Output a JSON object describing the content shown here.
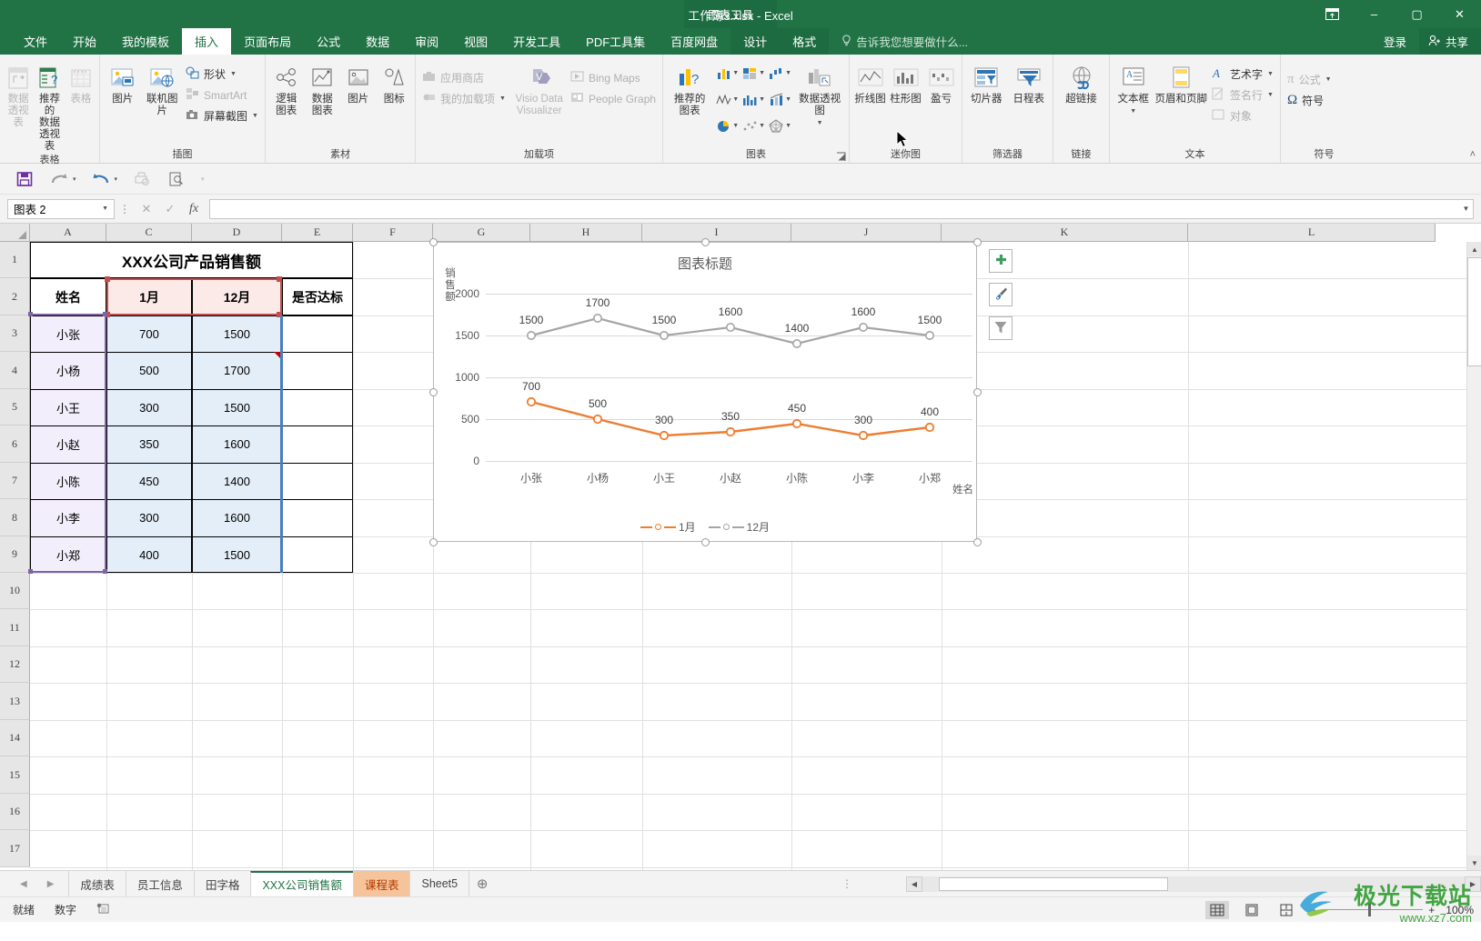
{
  "window": {
    "title": "工作簿3.xlsx - Excel",
    "context_tab_group": "图表工具",
    "ribbon_display_icon": "ribbon-display-options-icon",
    "minimize": "–",
    "maximize": "▢",
    "close": "✕"
  },
  "header": {
    "tabs": [
      {
        "label": "文件",
        "active": false
      },
      {
        "label": "开始",
        "active": false
      },
      {
        "label": "我的模板",
        "active": false
      },
      {
        "label": "插入",
        "active": true
      },
      {
        "label": "页面布局",
        "active": false
      },
      {
        "label": "公式",
        "active": false
      },
      {
        "label": "数据",
        "active": false
      },
      {
        "label": "审阅",
        "active": false
      },
      {
        "label": "视图",
        "active": false
      },
      {
        "label": "开发工具",
        "active": false
      },
      {
        "label": "PDF工具集",
        "active": false
      },
      {
        "label": "百度网盘",
        "active": false
      }
    ],
    "context_tabs": [
      {
        "label": "设计",
        "active": true
      },
      {
        "label": "格式",
        "active": false
      }
    ],
    "tell_me": "告诉我您想要做什么...",
    "signin": "登录",
    "share": "共享"
  },
  "ribbon": {
    "groups": [
      {
        "name": "表格",
        "label": "表格",
        "big_buttons": [
          {
            "label": "数据\n透视表",
            "line1": "数据",
            "line2": "透视表",
            "icon": "pivot-table-icon",
            "disabled": true
          },
          {
            "label": "推荐的\n数据透视表",
            "line1": "推荐的",
            "line2": "数据透视表",
            "icon": "recommended-pivot-icon",
            "disabled": false
          },
          {
            "label": "表格",
            "line1": "表格",
            "line2": "",
            "icon": "table-icon",
            "disabled": true
          }
        ]
      },
      {
        "name": "插图",
        "label": "插图",
        "big_buttons": [
          {
            "line1": "图片",
            "line2": "",
            "icon": "picture-icon",
            "disabled": false
          },
          {
            "line1": "联机图片",
            "line2": "",
            "icon": "online-picture-icon",
            "disabled": false
          }
        ],
        "small_rows": [
          {
            "label": "形状",
            "icon": "shapes-icon",
            "caret": true,
            "disabled": false
          },
          {
            "label": "SmartArt",
            "icon": "smartart-icon",
            "caret": false,
            "disabled": true
          },
          {
            "label": "屏幕截图",
            "icon": "screenshot-icon",
            "caret": true,
            "disabled": false
          }
        ]
      },
      {
        "name": "素材",
        "label": "素材",
        "big_buttons": [
          {
            "line1": "逻辑",
            "line2": "图表",
            "icon": "logic-diagram-icon",
            "disabled": false
          },
          {
            "line1": "数据",
            "line2": "图表",
            "icon": "data-chart-icon",
            "disabled": false
          },
          {
            "line1": "图片",
            "line2": "",
            "icon": "material-picture-icon",
            "disabled": false
          },
          {
            "line1": "图标",
            "line2": "",
            "icon": "material-icon-icon",
            "disabled": false
          }
        ]
      },
      {
        "name": "加载项",
        "label": "加载项",
        "small_rows": [
          {
            "label": "应用商店",
            "icon": "store-icon",
            "caret": false,
            "disabled": true
          },
          {
            "label": "我的加载项",
            "icon": "my-addins-icon",
            "caret": true,
            "disabled": true
          }
        ],
        "big_buttons": [
          {
            "line1": "Visio Data",
            "line2": "Visualizer",
            "icon": "visio-data-visualizer-icon",
            "disabled": true
          }
        ],
        "small_rows2": [
          {
            "label": "Bing Maps",
            "icon": "bing-maps-icon",
            "caret": false,
            "disabled": true
          },
          {
            "label": "People Graph",
            "icon": "people-graph-icon",
            "caret": false,
            "disabled": true
          }
        ]
      },
      {
        "name": "图表",
        "label": "图表",
        "big_buttons": [
          {
            "line1": "推荐的",
            "line2": "图表",
            "icon": "recommended-charts-icon",
            "disabled": false
          },
          {
            "line1": "数据透视图",
            "line2": "",
            "icon": "pivot-chart-icon",
            "disabled": false
          }
        ],
        "mini_icons": [
          "column-chart-icon",
          "hierarchy-chart-icon",
          "waterfall-chart-icon",
          "line-chart-icon",
          "statistic-chart-icon",
          "combo-chart-icon",
          "pie-chart-icon",
          "scatter-chart-icon",
          "radar-chart-icon"
        ],
        "has_launcher": true
      },
      {
        "name": "迷你图",
        "label": "迷你图",
        "big_buttons": [
          {
            "line1": "折线图",
            "line2": "",
            "icon": "sparkline-line-icon",
            "disabled": false
          },
          {
            "line1": "柱形图",
            "line2": "",
            "icon": "sparkline-column-icon",
            "disabled": false
          },
          {
            "line1": "盈亏",
            "line2": "",
            "icon": "sparkline-winloss-icon",
            "disabled": false
          }
        ]
      },
      {
        "name": "筛选器",
        "label": "筛选器",
        "big_buttons": [
          {
            "line1": "切片器",
            "line2": "",
            "icon": "slicer-icon",
            "disabled": false
          },
          {
            "line1": "日程表",
            "line2": "",
            "icon": "timeline-icon",
            "disabled": false
          }
        ]
      },
      {
        "name": "链接",
        "label": "链接",
        "big_buttons": [
          {
            "line1": "超链接",
            "line2": "",
            "icon": "hyperlink-icon",
            "disabled": false
          }
        ]
      },
      {
        "name": "文本",
        "label": "文本",
        "big_buttons": [
          {
            "line1": "文本框",
            "line2": "",
            "icon": "textbox-icon",
            "disabled": false
          },
          {
            "line1": "页眉和页脚",
            "line2": "",
            "icon": "header-footer-icon",
            "disabled": false
          }
        ],
        "small_rows": [
          {
            "label": "艺术字",
            "icon": "wordart-icon",
            "caret": true,
            "disabled": false
          },
          {
            "label": "签名行",
            "icon": "signature-line-icon",
            "caret": true,
            "disabled": true
          },
          {
            "label": "对象",
            "icon": "object-icon",
            "caret": false,
            "disabled": true
          }
        ]
      },
      {
        "name": "符号",
        "label": "符号",
        "small_rows": [
          {
            "label": "公式",
            "icon": "equation-icon",
            "caret": true,
            "disabled": true
          },
          {
            "label": "符号",
            "icon": "symbol-icon",
            "caret": false,
            "disabled": false
          }
        ]
      }
    ],
    "collapse_icon": "collapse-ribbon-icon"
  },
  "quick_access": [
    {
      "name": "save-icon",
      "glyph": "💾",
      "disabled": false
    },
    {
      "name": "redo-icon",
      "glyph": "↷",
      "disabled": false
    },
    {
      "name": "undo-icon",
      "glyph": "↶",
      "disabled": false
    },
    {
      "name": "print-preview-icon",
      "glyph": "🖶",
      "disabled": true
    },
    {
      "name": "print-preview-magnifier-icon",
      "glyph": "🔍",
      "disabled": false
    },
    {
      "name": "customize-qat-icon",
      "glyph": "▾",
      "disabled": true
    }
  ],
  "formula_bar": {
    "name_box_value": "图表 2",
    "cancel_icon": "cancel-icon",
    "confirm_icon": "confirm-icon",
    "fx_icon": "insert-function-icon",
    "value": "",
    "expand_icon": "expand-formula-bar-icon"
  },
  "grid": {
    "columns": [
      "A",
      "C",
      "D",
      "E",
      "F",
      "G",
      "H",
      "I",
      "J",
      "K",
      "L"
    ],
    "rows": [
      "1",
      "2",
      "3",
      "4",
      "5",
      "6",
      "7",
      "8",
      "9",
      "10",
      "11",
      "12",
      "13",
      "14",
      "15",
      "16",
      "17"
    ],
    "table": {
      "title": "XXX公司产品销售额",
      "headers": [
        "姓名",
        "1月",
        "12月",
        "是否达标"
      ],
      "rows": [
        {
          "name": "小张",
          "jan": "700",
          "dec": "1500",
          "ok": ""
        },
        {
          "name": "小杨",
          "jan": "500",
          "dec": "1700",
          "ok": ""
        },
        {
          "name": "小王",
          "jan": "300",
          "dec": "1500",
          "ok": ""
        },
        {
          "name": "小赵",
          "jan": "350",
          "dec": "1600",
          "ok": ""
        },
        {
          "name": "小陈",
          "jan": "450",
          "dec": "1400",
          "ok": ""
        },
        {
          "name": "小李",
          "jan": "300",
          "dec": "1600",
          "ok": ""
        },
        {
          "name": "小郑",
          "jan": "400",
          "dec": "1500",
          "ok": ""
        }
      ]
    }
  },
  "chart_data": {
    "type": "line",
    "title": "图表标题",
    "xlabel": "姓名",
    "ylabel": "销售额",
    "categories": [
      "小张",
      "小杨",
      "小王",
      "小赵",
      "小陈",
      "小李",
      "小郑"
    ],
    "series": [
      {
        "name": "1月",
        "color": "#ED7D31",
        "values": [
          700,
          500,
          300,
          350,
          450,
          300,
          400
        ]
      },
      {
        "name": "12月",
        "color": "#A5A5A5",
        "values": [
          1500,
          1700,
          1500,
          1600,
          1400,
          1600,
          1500
        ]
      }
    ],
    "ylim": [
      0,
      2000
    ],
    "yticks": [
      0,
      500,
      1000,
      1500,
      2000
    ],
    "grid": true,
    "legend_position": "bottom",
    "data_labels": true
  },
  "chart_side_buttons": [
    {
      "name": "chart-elements-button",
      "icon": "plus-icon",
      "glyph": "✚",
      "color": "#3f9c5f"
    },
    {
      "name": "chart-styles-button",
      "icon": "brush-icon",
      "glyph": "🖌",
      "color": "#5a5a5a"
    },
    {
      "name": "chart-filters-button",
      "icon": "funnel-icon",
      "glyph": "▼",
      "color": "#9a9a9a"
    }
  ],
  "sheet_tabs": {
    "nav_prev": "◀",
    "nav_next": "▶",
    "items": [
      {
        "label": "成绩表",
        "state": "normal"
      },
      {
        "label": "员工信息",
        "state": "normal"
      },
      {
        "label": "田字格",
        "state": "normal"
      },
      {
        "label": "XXX公司销售额",
        "state": "active"
      },
      {
        "label": "课程表",
        "state": "highlight"
      },
      {
        "label": "Sheet5",
        "state": "normal"
      }
    ],
    "add_label": "⊕"
  },
  "status_bar": {
    "mode": "就绪",
    "num_mode": "数字",
    "macro_icon": "record-macro-icon",
    "views": [
      {
        "name": "normal-view-button",
        "icon": "grid-view-icon",
        "active": true
      },
      {
        "name": "page-layout-view-button",
        "icon": "page-layout-icon",
        "active": false
      },
      {
        "name": "page-break-view-button",
        "icon": "page-break-icon",
        "active": false
      }
    ],
    "zoom_out": "−",
    "zoom_in": "+",
    "zoom_level": "100%"
  },
  "watermark": {
    "text": "极光下载站",
    "sub": "www.xz7.com"
  }
}
